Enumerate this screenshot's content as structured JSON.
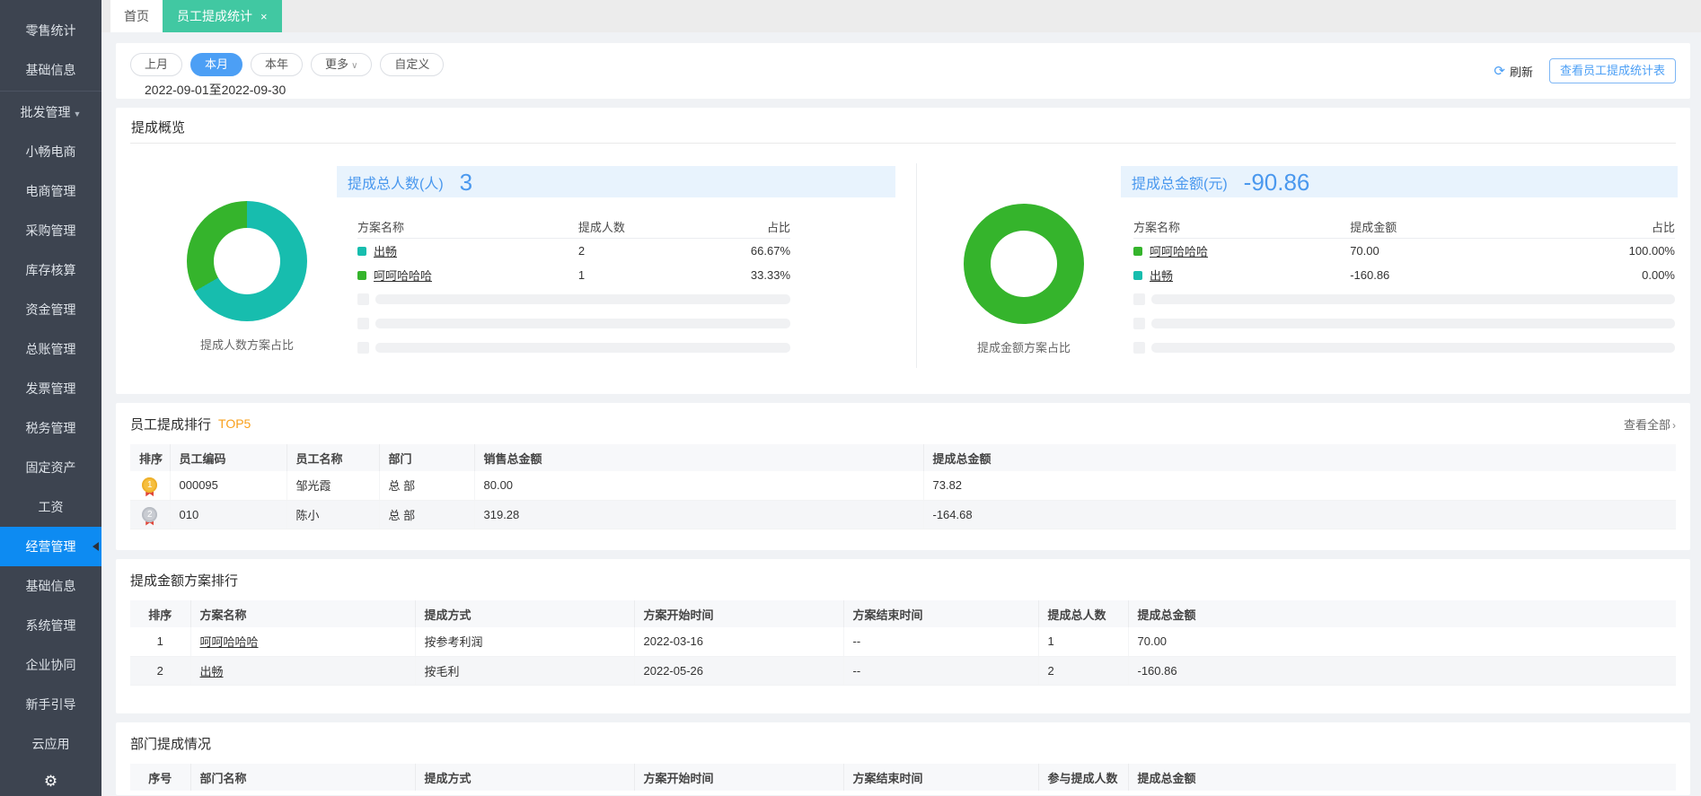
{
  "sidebar": {
    "items": [
      {
        "label": "零售统计"
      },
      {
        "label": "基础信息"
      },
      {
        "label": "批发管理",
        "arrow": "▼"
      },
      {
        "label": "小畅电商"
      },
      {
        "label": "电商管理"
      },
      {
        "label": "采购管理"
      },
      {
        "label": "库存核算"
      },
      {
        "label": "资金管理"
      },
      {
        "label": "总账管理"
      },
      {
        "label": "发票管理"
      },
      {
        "label": "税务管理"
      },
      {
        "label": "固定资产"
      },
      {
        "label": "工资"
      },
      {
        "label": "经营管理",
        "active": true
      },
      {
        "label": "基础信息"
      },
      {
        "label": "系统管理"
      },
      {
        "label": "企业协同"
      },
      {
        "label": "新手引导"
      },
      {
        "label": "云应用"
      }
    ],
    "gear_icon": "⚙"
  },
  "tabs": {
    "home": "首页",
    "active": "员工提成统计",
    "close_icon": "×"
  },
  "toolbar": {
    "pills": [
      {
        "label": "上月"
      },
      {
        "label": "本月",
        "active": true
      },
      {
        "label": "本年"
      },
      {
        "label": "更多",
        "chevron": "∨"
      },
      {
        "label": "自定义"
      }
    ],
    "date_range": "2022-09-01至2022-09-30",
    "refresh_icon": "⟳",
    "refresh_label": "刷新",
    "view_report_label": "查看员工提成统计表"
  },
  "overview": {
    "title": "提成概览",
    "left": {
      "stat_label": "提成总人数(人)",
      "stat_value": "3",
      "caption": "提成人数方案占比",
      "headers": [
        "方案名称",
        "提成人数",
        "占比"
      ],
      "rows": [
        {
          "name": "出畅",
          "value": "2",
          "percent": "66.67%",
          "color": "#17bdae"
        },
        {
          "name": "呵呵哈哈哈",
          "value": "1",
          "percent": "33.33%",
          "color": "#35b42c"
        }
      ],
      "donut": [
        {
          "color": "#17bdae",
          "pct": 66.67
        },
        {
          "color": "#35b42c",
          "pct": 33.33
        }
      ]
    },
    "right": {
      "stat_label": "提成总金额(元)",
      "stat_value": "-90.86",
      "caption": "提成金额方案占比",
      "headers": [
        "方案名称",
        "提成金额",
        "占比"
      ],
      "rows": [
        {
          "name": "呵呵哈哈哈",
          "value": "70.00",
          "percent": "100.00%",
          "color": "#35b42c"
        },
        {
          "name": "出畅",
          "value": "-160.86",
          "percent": "0.00%",
          "color": "#17bdae"
        }
      ],
      "donut": [
        {
          "color": "#35b42c",
          "pct": 100
        }
      ]
    }
  },
  "employee_ranking": {
    "title": "员工提成排行",
    "badge": "TOP5",
    "view_all": "查看全部",
    "view_all_chevron": "›",
    "headers": [
      "排序",
      "员工编码",
      "员工名称",
      "部门",
      "销售总金额",
      "提成总金额"
    ],
    "rows": [
      {
        "rank": "1",
        "code": "000095",
        "name": "邹光霞",
        "dept": "总 部",
        "sales": "80.00",
        "commission": "73.82"
      },
      {
        "rank": "2",
        "code": "010",
        "name": "陈小",
        "dept": "总 部",
        "sales": "319.28",
        "commission": "-164.68"
      }
    ]
  },
  "scheme_ranking": {
    "title": "提成金额方案排行",
    "headers": [
      "排序",
      "方案名称",
      "提成方式",
      "方案开始时间",
      "方案结束时间",
      "提成总人数",
      "提成总金额"
    ],
    "rows": [
      {
        "rank": "1",
        "name": "呵呵哈哈哈",
        "method": "按参考利润",
        "start": "2022-03-16",
        "end": "--",
        "people": "1",
        "amount": "70.00"
      },
      {
        "rank": "2",
        "name": "出畅",
        "method": "按毛利",
        "start": "2022-05-26",
        "end": "--",
        "people": "2",
        "amount": "-160.86"
      }
    ]
  },
  "department": {
    "title": "部门提成情况",
    "headers": [
      "序号",
      "部门名称",
      "提成方式",
      "方案开始时间",
      "方案结束时间",
      "参与提成人数",
      "提成总金额"
    ]
  },
  "colors": {
    "accent_blue": "#4c9ff5",
    "active_tab_green": "#41c8a2",
    "sidebar_active_blue": "#0d8bf2",
    "teal_series": "#17bdae",
    "green_series": "#35b42c",
    "top5_orange": "#f9a01b"
  }
}
